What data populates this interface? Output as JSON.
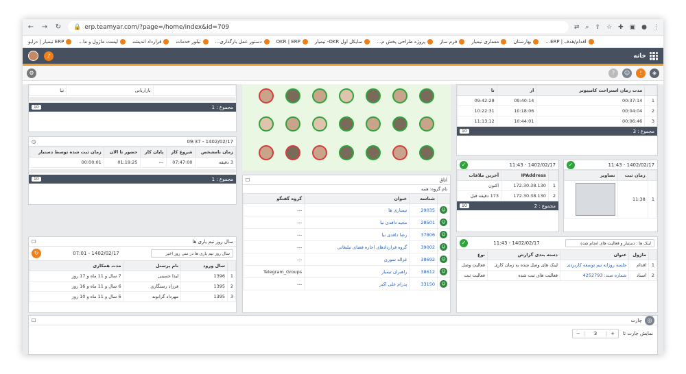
{
  "browser": {
    "url": "erp.teamyar.com/?page=/home/index&id=709"
  },
  "bookmarks": [
    "اقدام/هدف | ERP...",
    "بهارستان",
    "معماری تیمیار",
    "فرم ساز",
    "پروژه طراحی پخش م...",
    "سایکل اول OKR- تیمیار",
    "OKR | ERP",
    "دستور عمل بارگذاری...",
    "تیلور خدمات",
    "قرارداد اندیشه",
    "لیست ماژول و ما...",
    "ERP تیمیار | درایو"
  ],
  "app": {
    "title": "خانه"
  },
  "p1": {
    "c1": "بازاریابی",
    "c2": "نیا",
    "sum": "مجموع : 1",
    "page": "10"
  },
  "p2": {
    "date": "1402/02/17 - 09:37",
    "headers": [
      "زمان نامشخص",
      "شروع کار",
      "پایان کار",
      "حضور تا الان",
      "زمان ثبت شده توسط دستیار"
    ],
    "row": [
      "3 دقیقه",
      "07:47:00",
      "---",
      "01:19:25",
      "00:00:01"
    ],
    "sum": "مجموع : 1",
    "page": "10"
  },
  "p3": {
    "title": "سال روز تیم یاری ها",
    "filter": "سال روز تیم یاری ها در سی روز اخیر",
    "date": "1402/02/17 - 07:01",
    "headers": [
      "سال ورود",
      "نام پرسنل",
      "مدت همکاری"
    ],
    "rows": [
      [
        "1",
        "1396",
        "لیدا حسینی",
        "7 سال و 11 ماه و 17 روز"
      ],
      [
        "2",
        "1395",
        "فرزاد رستگاری",
        "6 سال و 11 ماه و 16 روز"
      ],
      [
        "3",
        "1395",
        "مهرداد گرانوند",
        "6 سال و 11 ماه و 10 روز"
      ]
    ]
  },
  "p4": {
    "title": "اتاق",
    "group": "نام گروه: همه",
    "headers": [
      "شناسه",
      "عنوان",
      "گروه گفتگو"
    ],
    "rows": [
      [
        "29035",
        "تیمیاری ها",
        "---"
      ],
      [
        "28501",
        "مجید داقدی نیا",
        "---"
      ],
      [
        "37806",
        "رضا داقدی نیا",
        "---"
      ],
      [
        "39002",
        "گروه قراردادهای اجاره فضای تبلیغاتی",
        "---"
      ],
      [
        "38692",
        "غزاله تموری",
        "---"
      ],
      [
        "38612",
        "راهبران تیمیار",
        "Telegram_Groups"
      ],
      [
        "33150",
        "پدرام علی اکبر",
        "---"
      ]
    ]
  },
  "p5": {
    "header": "مدت زمان استراحت کامپیوتر",
    "cols": [
      "از",
      "تا"
    ],
    "rows": [
      [
        "1",
        "00:37:14",
        "09:40:14",
        "09:42:28"
      ],
      [
        "2",
        "00:04:04",
        "10:18:06",
        "10:22:31"
      ],
      [
        "3",
        "00:06:46",
        "10:44:01",
        "11:13:12"
      ]
    ],
    "sum": "مجموع : 3",
    "page": "10"
  },
  "p6": {
    "date": "1402/02/17 - 11:43",
    "headers": [
      "IPAddress",
      "آخرین ملاقات"
    ],
    "rows": [
      [
        "1",
        "172.30.38.130",
        "اکنون"
      ],
      [
        "2",
        "172.30.38.130",
        "173 دقیقه قبل"
      ]
    ],
    "sum": "مجموع : 2",
    "page": "10"
  },
  "p7": {
    "date": "1402/02/17 - 11:43",
    "headers": [
      "تصاویر",
      "زمان ثبت"
    ],
    "row": [
      "1",
      "11:38"
    ]
  },
  "p8": {
    "filter": "لینک ها : دستیار و فعالیت های انجام شده",
    "date": "1402/02/17 - 11:43",
    "headers": [
      "ماژول",
      "عنوان",
      "دسته بندی گزارش",
      "نوع"
    ],
    "rows": [
      [
        "1",
        "اقدام",
        "جلسه روزانه تیم توسعه کاربردی",
        "لینک های وصل شده به زمان کاری",
        "فعالیت وصل"
      ],
      [
        "2",
        "اسناد",
        "شماره سند: 4252793",
        "فعالیت های ثبت شده",
        "فعالیت ثبت"
      ]
    ]
  },
  "chart": {
    "title": "چارت",
    "label": "نمایش چارت تا",
    "value": "3"
  },
  "colors": {
    "appbar": "#46505e",
    "accent": "#ef7f1a",
    "green": "#2ca43a"
  }
}
